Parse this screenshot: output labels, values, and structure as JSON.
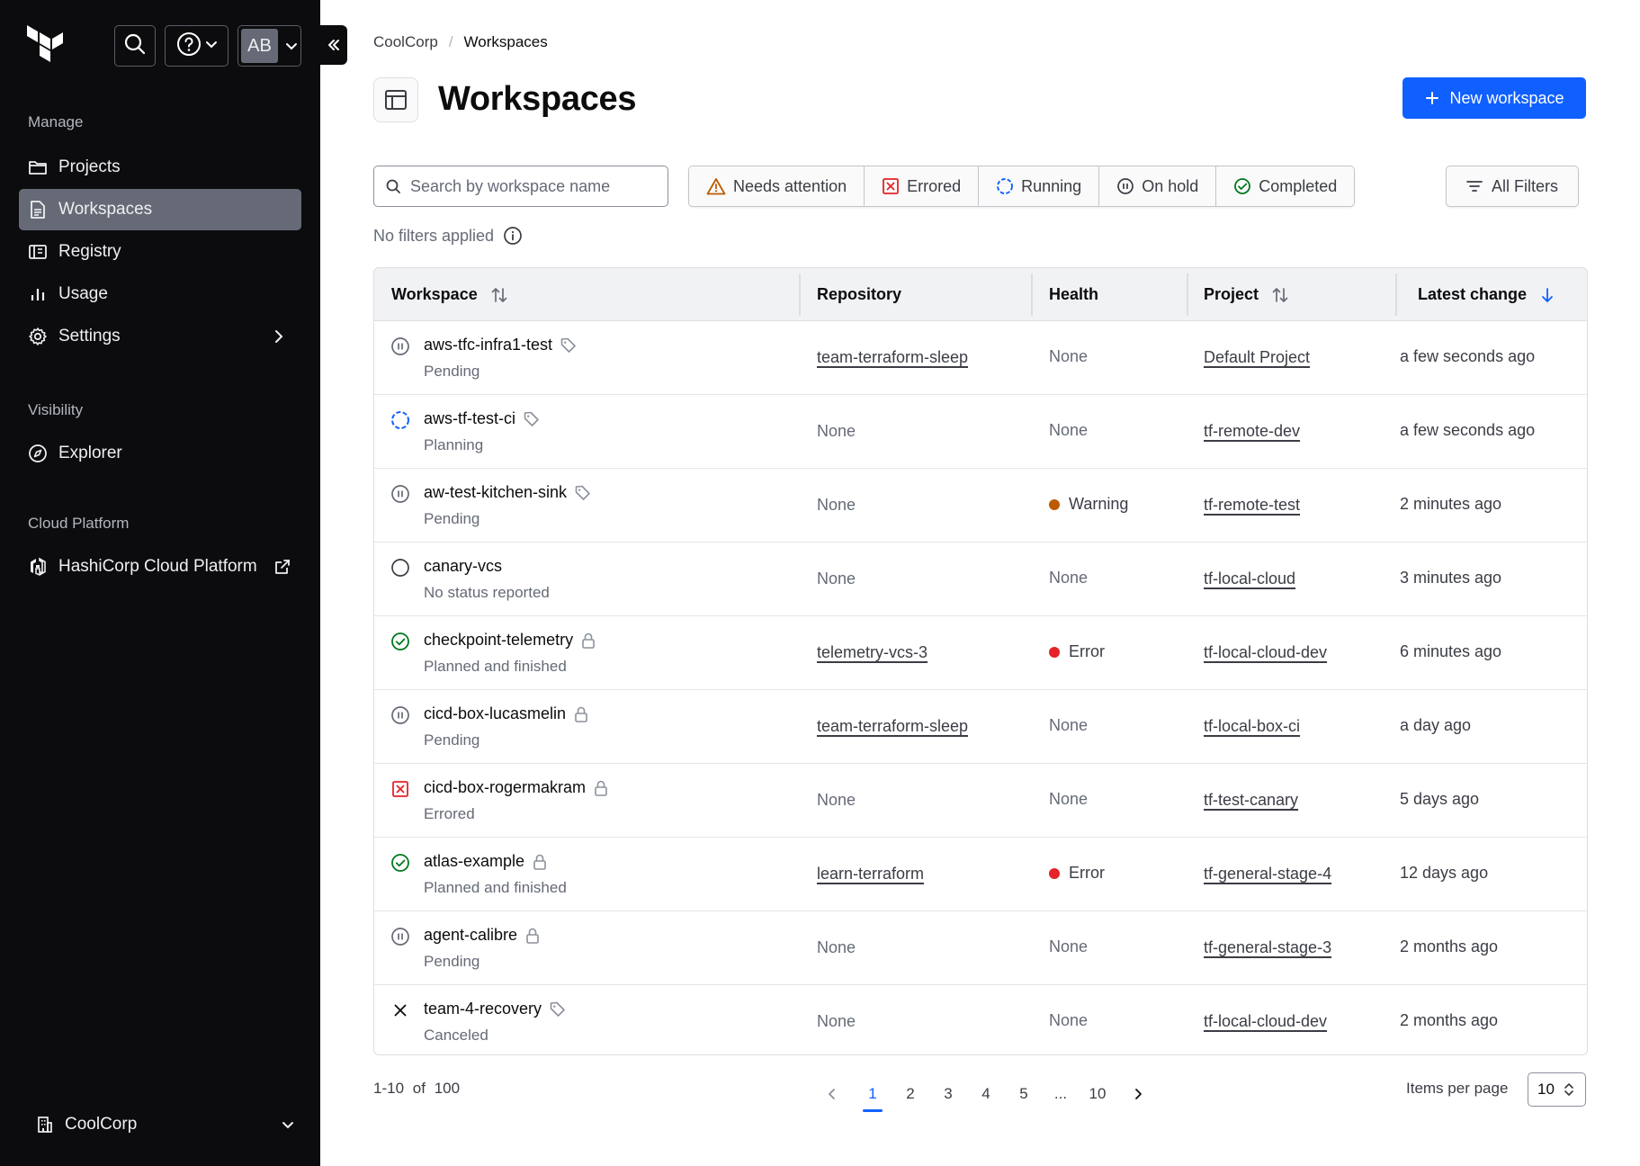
{
  "sidebar": {
    "user_initials": "AB",
    "sections": {
      "manage": "Manage",
      "visibility": "Visibility",
      "cloud_platform": "Cloud Platform"
    },
    "items": {
      "projects": "Projects",
      "workspaces": "Workspaces",
      "registry": "Registry",
      "usage": "Usage",
      "settings": "Settings",
      "explorer": "Explorer",
      "hcp": "HashiCorp Cloud Platform"
    },
    "active_item": "workspaces",
    "org_name": "CoolCorp"
  },
  "breadcrumb": {
    "org": "CoolCorp",
    "separator": "/",
    "current": "Workspaces"
  },
  "page": {
    "title": "Workspaces",
    "new_button": "New workspace"
  },
  "search": {
    "placeholder": "Search by workspace name",
    "value": ""
  },
  "filters": {
    "needs_attention": "Needs attention",
    "errored": "Errored",
    "running": "Running",
    "on_hold": "On hold",
    "completed": "Completed",
    "all_filters": "All Filters",
    "status_text": "No filters applied"
  },
  "table": {
    "columns": {
      "workspace": "Workspace",
      "repository": "Repository",
      "health": "Health",
      "project": "Project",
      "latest_change": "Latest change"
    },
    "rows": [
      {
        "icon": "pending-icon",
        "name": "aws-tfc-infra1-test",
        "badge": "tag-icon",
        "status": "Pending",
        "repository": "team-terraform-sleep",
        "repo_link": true,
        "health": "None",
        "health_color": "",
        "project": "Default Project",
        "latest_change": "a few seconds ago"
      },
      {
        "icon": "running-icon",
        "name": "aws-tf-test-ci",
        "badge": "tag-icon",
        "status": "Planning",
        "repository": "None",
        "repo_link": false,
        "health": "None",
        "health_color": "",
        "project": "tf-remote-dev",
        "latest_change": "a few seconds ago"
      },
      {
        "icon": "pending-icon",
        "name": "aw-test-kitchen-sink",
        "badge": "tag-icon",
        "status": "Pending",
        "repository": "None",
        "repo_link": false,
        "health": "Warning",
        "health_color": "#bb5a00",
        "project": "tf-remote-test",
        "latest_change": "2 minutes ago"
      },
      {
        "icon": "no-status-icon",
        "name": "canary-vcs",
        "badge": "",
        "status": "No status reported",
        "repository": "None",
        "repo_link": false,
        "health": "None",
        "health_color": "",
        "project": "tf-local-cloud",
        "latest_change": "3 minutes ago"
      },
      {
        "icon": "completed-icon",
        "name": "checkpoint-telemetry",
        "badge": "lock-icon",
        "status": "Planned and finished",
        "repository": "telemetry-vcs-3",
        "repo_link": true,
        "health": "Error",
        "health_color": "#e52228",
        "project": "tf-local-cloud-dev",
        "latest_change": "6 minutes ago"
      },
      {
        "icon": "pending-icon",
        "name": "cicd-box-lucasmelin",
        "badge": "lock-icon",
        "status": "Pending",
        "repository": "team-terraform-sleep",
        "repo_link": true,
        "health": "None",
        "health_color": "",
        "project": "tf-local-box-ci",
        "latest_change": "a day ago"
      },
      {
        "icon": "errored-icon",
        "name": "cicd-box-rogermakram",
        "badge": "lock-icon",
        "status": "Errored",
        "repository": "None",
        "repo_link": false,
        "health": "None",
        "health_color": "",
        "project": "tf-test-canary",
        "latest_change": "5 days ago"
      },
      {
        "icon": "completed-icon",
        "name": "atlas-example",
        "badge": "lock-icon",
        "status": "Planned and finished",
        "repository": "learn-terraform",
        "repo_link": true,
        "health": "Error",
        "health_color": "#e52228",
        "project": "tf-general-stage-4",
        "latest_change": "12 days ago"
      },
      {
        "icon": "pending-icon",
        "name": "agent-calibre",
        "badge": "lock-icon",
        "status": "Pending",
        "repository": "None",
        "repo_link": false,
        "health": "None",
        "health_color": "",
        "project": "tf-general-stage-3",
        "latest_change": "2 months ago"
      },
      {
        "icon": "canceled-icon",
        "name": "team-4-recovery",
        "badge": "tag-icon",
        "status": "Canceled",
        "repository": "None",
        "repo_link": false,
        "health": "None",
        "health_color": "",
        "project": "tf-local-cloud-dev",
        "latest_change": "2 months ago"
      }
    ]
  },
  "pagination": {
    "range": "1-10",
    "of_label": "of",
    "total": "100",
    "pages": [
      "1",
      "2",
      "3",
      "4",
      "5"
    ],
    "ellipsis": "...",
    "last_page": "10",
    "current_page": "1",
    "items_per_page_label": "Items per page",
    "items_per_page": "10"
  },
  "colors": {
    "sidebar_bg": "#0c0c0e",
    "active_nav": "#656a76",
    "primary": "#1060ff",
    "warning": "#bb5a00",
    "error": "#e52228",
    "success": "#00781e"
  }
}
